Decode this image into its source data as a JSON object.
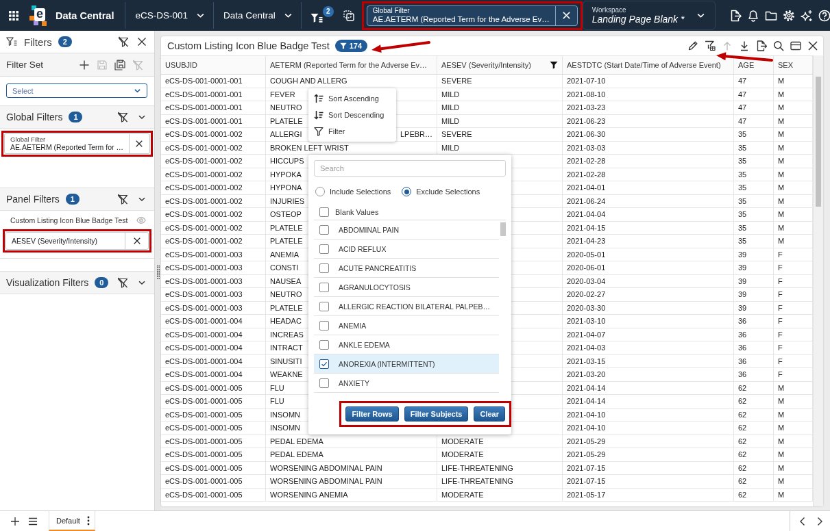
{
  "top_bar": {
    "logo_letter": "e",
    "app_name": "Data Central",
    "study": "eCS-DS-001",
    "module": "Data Central",
    "filter_count": "2",
    "global_filter": {
      "label": "Global Filter",
      "value": "AE.AETERM (Reported Term for the Adverse Ev…",
      "highlighted": true
    },
    "workspace": {
      "label": "Workspace",
      "name": "Landing Page Blank *"
    }
  },
  "filters_panel": {
    "title": "Filters",
    "count": "2",
    "filter_set": {
      "title": "Filter Set",
      "placeholder": "Select"
    },
    "sections": [
      {
        "kind": "global",
        "title": "Global Filters",
        "count": "1",
        "chips": [
          {
            "label": "Global Filter",
            "value": "AE.AETERM (Reported Term for …",
            "highlighted": true
          }
        ]
      },
      {
        "kind": "panel",
        "title": "Panel Filters",
        "count": "1",
        "panel_name": "Custom Listing Icon Blue Badge Test",
        "chips": [
          {
            "value": "AESEV (Severity/Intensity)",
            "highlighted": true
          }
        ]
      },
      {
        "kind": "visualization",
        "title": "Visualization Filters",
        "count": "0"
      }
    ]
  },
  "listing": {
    "title": "Custom Listing Icon Blue Badge Test",
    "row_count": "174",
    "columns": [
      {
        "label": "USUBJID",
        "filtered": false
      },
      {
        "label": "AETERM (Reported Term for the Adverse Ev…",
        "filtered": false
      },
      {
        "label": "AESEV (Severity/Intensity)",
        "filtered": true
      },
      {
        "label": "AESTDTC (Start Date/Time of Adverse Event)",
        "filtered": false
      },
      {
        "label": "AGE",
        "filtered": false
      },
      {
        "label": "SEX",
        "filtered": false
      }
    ],
    "rows": [
      {
        "usubjid": "eCS-DS-001-0001-001",
        "aeterm": [
          "COUGH AND ALLERG"
        ],
        "aesev": "SEVERE",
        "aestdtc": "2021-07-10",
        "age": "47",
        "sex": "M"
      },
      {
        "usubjid": "eCS-DS-001-0001-001",
        "aeterm": [
          "FEVER"
        ],
        "aesev": "MILD",
        "aestdtc": "2021-08-10",
        "age": "47",
        "sex": "M"
      },
      {
        "usubjid": "eCS-DS-001-0001-001",
        "aeterm": [
          "NEUTRO"
        ],
        "aesev": "MILD",
        "aestdtc": "2021-03-23",
        "age": "47",
        "sex": "M"
      },
      {
        "usubjid": "eCS-DS-001-0001-001",
        "aeterm": [
          "PLATELE"
        ],
        "aesev": "MILD",
        "aestdtc": "2021-06-23",
        "age": "47",
        "sex": "M"
      },
      {
        "usubjid": "eCS-DS-001-0001-002",
        "aeterm": [
          "ALLERGI",
          "LPEBR…"
        ],
        "aesev": "SEVERE",
        "aestdtc": "2021-06-30",
        "age": "35",
        "sex": "M"
      },
      {
        "usubjid": "eCS-DS-001-0001-002",
        "aeterm": [
          "BROKEN LEFT WRIST"
        ],
        "aesev": "MILD",
        "aestdtc": "2021-03-03",
        "age": "35",
        "sex": "M"
      },
      {
        "usubjid": "eCS-DS-001-0001-002",
        "aeterm": [
          "HICCUPS"
        ],
        "aestdtc": "2021-02-28",
        "age": "35",
        "sex": "M"
      },
      {
        "usubjid": "eCS-DS-001-0001-002",
        "aeterm": [
          "HYPOKA"
        ],
        "aestdtc": "2021-02-28",
        "age": "35",
        "sex": "M"
      },
      {
        "usubjid": "eCS-DS-001-0001-002",
        "aeterm": [
          "HYPONA"
        ],
        "aestdtc": "2021-04-01",
        "age": "35",
        "sex": "M"
      },
      {
        "usubjid": "eCS-DS-001-0001-002",
        "aeterm": [
          "INJURIES"
        ],
        "aestdtc": "2021-06-24",
        "age": "35",
        "sex": "M"
      },
      {
        "usubjid": "eCS-DS-001-0001-002",
        "aeterm": [
          "OSTEOP"
        ],
        "aestdtc": "2021-04-04",
        "age": "35",
        "sex": "M"
      },
      {
        "usubjid": "eCS-DS-001-0001-002",
        "aeterm": [
          "PLATELE"
        ],
        "aestdtc": "2021-04-15",
        "age": "35",
        "sex": "M"
      },
      {
        "usubjid": "eCS-DS-001-0001-002",
        "aeterm": [
          "PLATELE"
        ],
        "aestdtc": "2021-04-23",
        "age": "35",
        "sex": "M"
      },
      {
        "usubjid": "eCS-DS-001-0001-003",
        "aeterm": [
          "ANEMIA"
        ],
        "aestdtc": "2020-05-01",
        "age": "39",
        "sex": "F"
      },
      {
        "usubjid": "eCS-DS-001-0001-003",
        "aeterm": [
          "CONSTI"
        ],
        "aestdtc": "2020-06-01",
        "age": "39",
        "sex": "F"
      },
      {
        "usubjid": "eCS-DS-001-0001-003",
        "aeterm": [
          "NAUSEA"
        ],
        "aestdtc": "2020-03-04",
        "age": "39",
        "sex": "F"
      },
      {
        "usubjid": "eCS-DS-001-0001-003",
        "aeterm": [
          "NEUTRO"
        ],
        "aestdtc": "2020-02-27",
        "age": "39",
        "sex": "F"
      },
      {
        "usubjid": "eCS-DS-001-0001-003",
        "aeterm": [
          "PLATELE"
        ],
        "aestdtc": "2020-03-30",
        "age": "39",
        "sex": "F"
      },
      {
        "usubjid": "eCS-DS-001-0001-004",
        "aeterm": [
          "HEADAC"
        ],
        "aestdtc": "2021-03-10",
        "age": "36",
        "sex": "F"
      },
      {
        "usubjid": "eCS-DS-001-0001-004",
        "aeterm": [
          "INCREAS"
        ],
        "aestdtc": "2021-04-07",
        "age": "36",
        "sex": "F"
      },
      {
        "usubjid": "eCS-DS-001-0001-004",
        "aeterm": [
          "INTRACT"
        ],
        "aestdtc": "2021-04-03",
        "age": "36",
        "sex": "F"
      },
      {
        "usubjid": "eCS-DS-001-0001-004",
        "aeterm": [
          "SINUSITI"
        ],
        "aestdtc": "2021-03-15",
        "age": "36",
        "sex": "F"
      },
      {
        "usubjid": "eCS-DS-001-0001-004",
        "aeterm": [
          "WEAKNE"
        ],
        "aestdtc": "2021-03-20",
        "age": "36",
        "sex": "F"
      },
      {
        "usubjid": "eCS-DS-001-0001-005",
        "aeterm": [
          "FLU"
        ],
        "aestdtc": "2021-04-14",
        "age": "62",
        "sex": "M"
      },
      {
        "usubjid": "eCS-DS-001-0001-005",
        "aeterm": [
          "FLU"
        ],
        "aestdtc": "2021-04-14",
        "age": "62",
        "sex": "M"
      },
      {
        "usubjid": "eCS-DS-001-0001-005",
        "aeterm": [
          "INSOMN"
        ],
        "aestdtc": "2021-04-10",
        "age": "62",
        "sex": "M"
      },
      {
        "usubjid": "eCS-DS-001-0001-005",
        "aeterm": [
          "INSOMN"
        ],
        "aestdtc": "2021-04-10",
        "age": "62",
        "sex": "M"
      },
      {
        "usubjid": "eCS-DS-001-0001-005",
        "aeterm": [
          "PEDAL EDEMA"
        ],
        "aesev": "MODERATE",
        "aestdtc": "2021-05-29",
        "age": "62",
        "sex": "M"
      },
      {
        "usubjid": "eCS-DS-001-0001-005",
        "aeterm": [
          "PEDAL EDEMA"
        ],
        "aesev": "MODERATE",
        "aestdtc": "2021-05-29",
        "age": "62",
        "sex": "M"
      },
      {
        "usubjid": "eCS-DS-001-0001-005",
        "aeterm": [
          "WORSENING ABDOMINAL PAIN"
        ],
        "aesev": "LIFE-THREATENING",
        "aestdtc": "2021-07-15",
        "age": "62",
        "sex": "M"
      },
      {
        "usubjid": "eCS-DS-001-0001-005",
        "aeterm": [
          "WORSENING ABDOMINAL PAIN"
        ],
        "aesev": "LIFE-THREATENING",
        "aestdtc": "2021-07-15",
        "age": "62",
        "sex": "M"
      },
      {
        "usubjid": "eCS-DS-001-0001-005",
        "aeterm": [
          "WORSENING ANEMIA"
        ],
        "aesev": "MODERATE",
        "aestdtc": "2021-05-17",
        "age": "62",
        "sex": "M"
      }
    ]
  },
  "column_menu": {
    "items": [
      {
        "kind": "sort_asc",
        "label": "Sort Ascending"
      },
      {
        "kind": "sort_desc",
        "label": "Sort Descending"
      },
      {
        "kind": "filter",
        "label": "Filter"
      }
    ]
  },
  "filter_popup": {
    "search": {
      "placeholder": "Search"
    },
    "modes": [
      {
        "label": "Include Selections",
        "selected": false
      },
      {
        "label": "Exclude Selections",
        "selected": true
      }
    ],
    "blank_option": {
      "label": "Blank Values",
      "checked": false
    },
    "options": [
      {
        "label": "ABDOMINAL PAIN",
        "checked": false,
        "selected": false
      },
      {
        "label": "ACID REFLUX",
        "checked": false,
        "selected": false
      },
      {
        "label": "ACUTE PANCREATITIS",
        "checked": false,
        "selected": false
      },
      {
        "label": "AGRANULOCYTOSIS",
        "checked": false,
        "selected": false
      },
      {
        "label": "ALLERGIC REACTION BILATERAL PALPEB…",
        "checked": false,
        "selected": false
      },
      {
        "label": "ANEMIA",
        "checked": false,
        "selected": false
      },
      {
        "label": "ANKLE EDEMA",
        "checked": false,
        "selected": false
      },
      {
        "label": "ANOREXIA (INTERMITTENT)",
        "checked": true,
        "selected": true
      },
      {
        "label": "ANXIETY",
        "checked": false,
        "selected": false
      }
    ],
    "actions": [
      {
        "label": "Filter Rows"
      },
      {
        "label": "Filter Subjects"
      },
      {
        "label": "Clear"
      }
    ],
    "highlighted": true
  },
  "bottom_bar": {
    "tabs": [
      {
        "label": "Default",
        "selected": true
      }
    ]
  }
}
